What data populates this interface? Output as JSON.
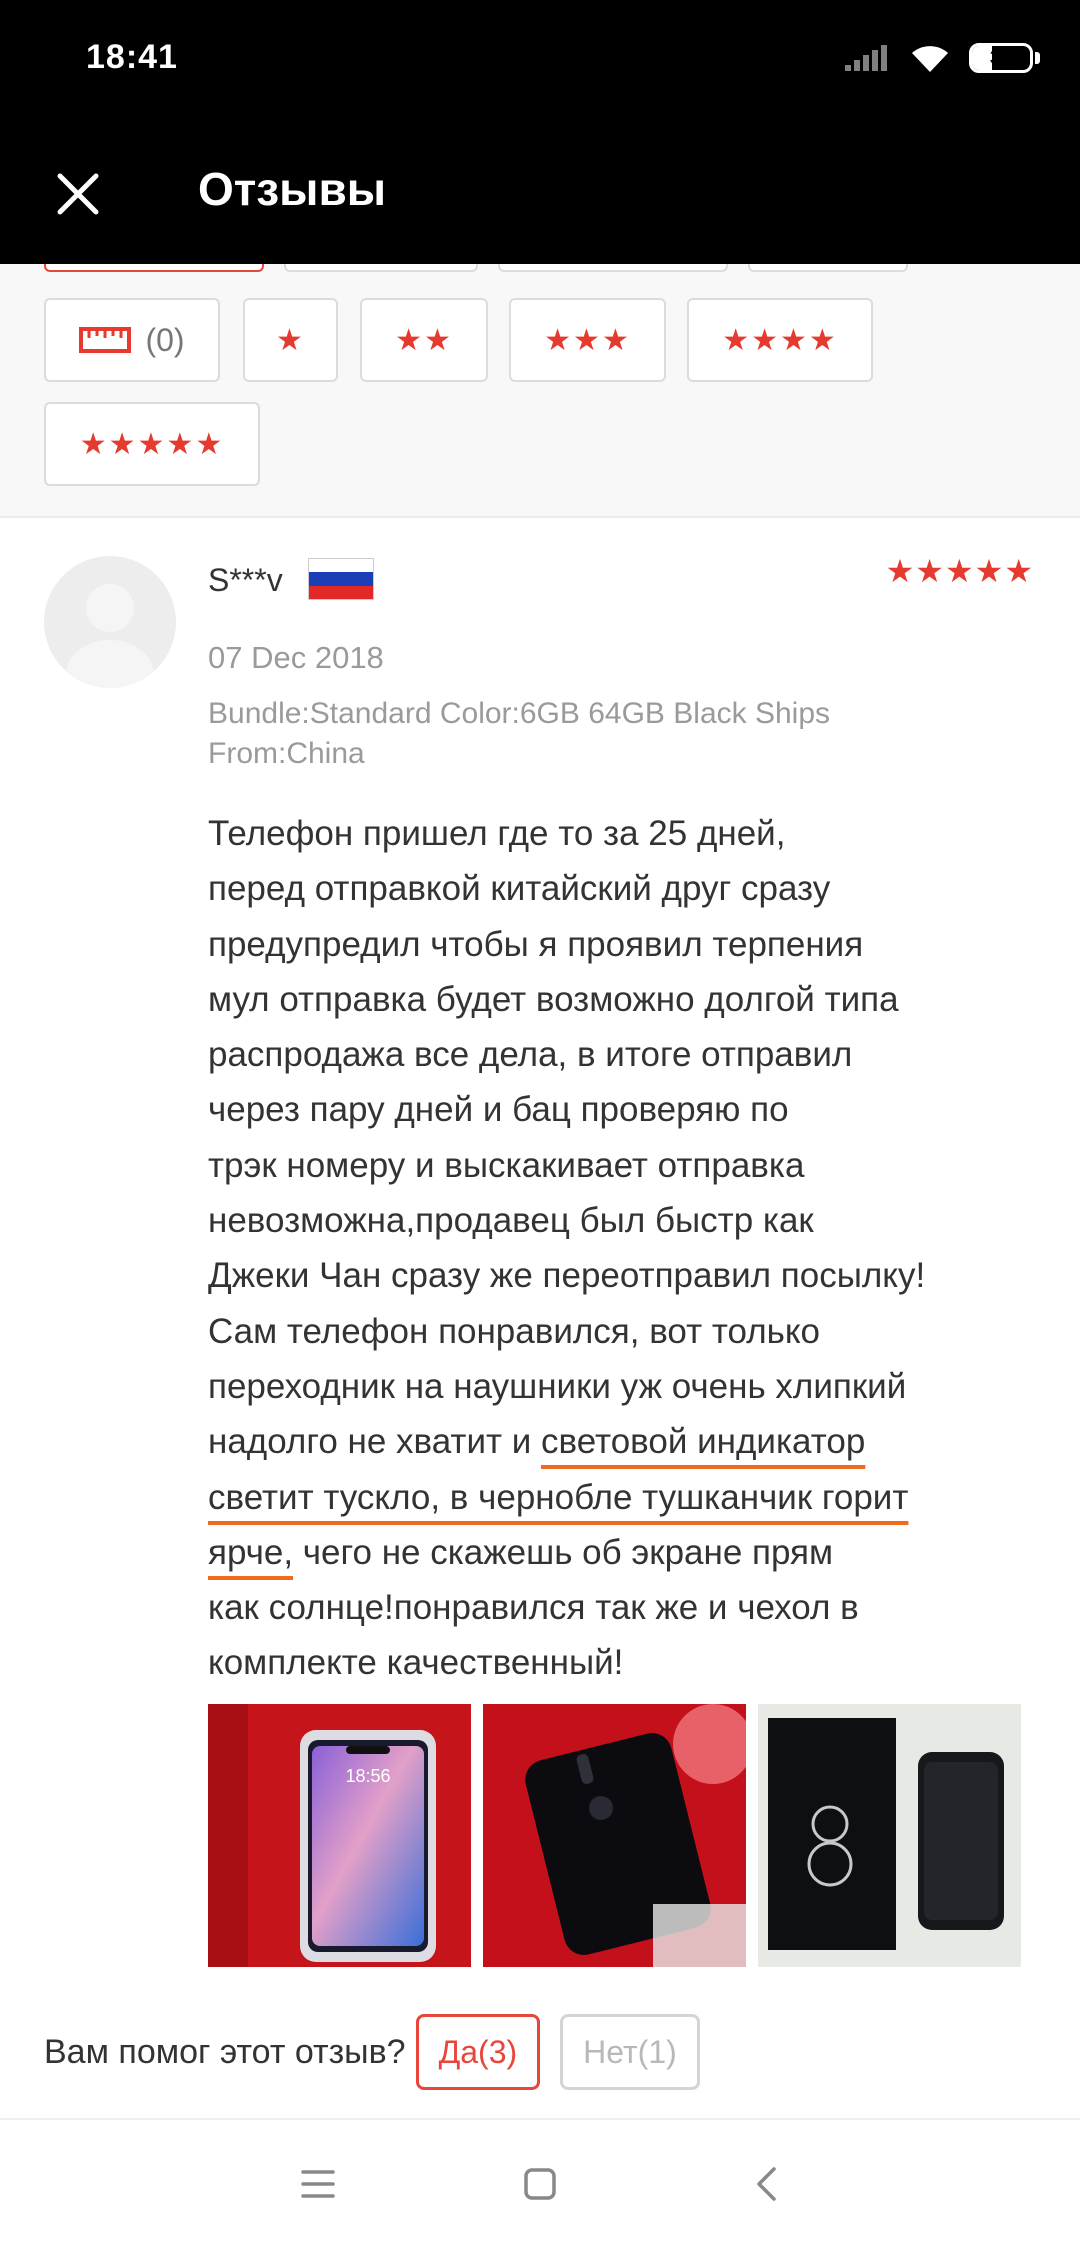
{
  "status_bar": {
    "time": "18:41",
    "battery_percent": "35",
    "battery_level": 0.35,
    "icons": [
      "signal-icon",
      "wifi-icon",
      "battery-icon"
    ]
  },
  "header": {
    "title": "Отзывы",
    "close_icon": "close-icon",
    "background": "#000000"
  },
  "filters": {
    "photo_chip": {
      "icon": "ruler-icon",
      "count": "(0)"
    },
    "star_chips": [
      {
        "stars": "★"
      },
      {
        "stars": "★★"
      },
      {
        "stars": "★★★"
      },
      {
        "stars": "★★★★"
      },
      {
        "stars": "★★★★★"
      }
    ],
    "accent": "#e8463b"
  },
  "review": {
    "author": "S***v",
    "country_flag": "russia-flag",
    "rating": 5,
    "rating_stars": "★★★★★",
    "date": "07 Dec 2018",
    "bundle_line1": "Bundle:Standard Color:6GB 64GB Black Ships",
    "bundle_line2": "From:China",
    "text_lines": [
      "Телефон пришел где то за 25 дней,",
      "перед отправкой китайский друг сразу",
      "предупредил чтобы я проявил терпения",
      "мул отправка будет возможно долгой типа",
      "распродажа все дела, в итоге отправил",
      "через пару дней и бац проверяю по",
      "трэк номеру и выскакивает отправка",
      "невозможна,продавец был быстр как",
      "Джеки Чан сразу же переотправил посылку!",
      "Сам телефон понравился, вот только",
      "переходник на наушники уж очень хлипкий"
    ],
    "line12_plain": "надолго не хватит и ",
    "line12_highlight": "световой индикатор",
    "line13_highlight": "светит тускло, в чернобле тушканчик горит",
    "line14_highlight": "ярче,",
    "line14_plain": " чего не скажешь об экране прям",
    "text_lines_end": [
      "как солнце!понравился так же и чехол в",
      "комплекте качественный!"
    ],
    "highlight_color": "#f26a1b",
    "photo_screen_time": "18:56",
    "photos": [
      "phone-front-photo",
      "phone-back-photo",
      "phone-box-photo"
    ]
  },
  "helpful": {
    "question": "Вам помог этот отзыв?",
    "yes_label": "Да(3)",
    "no_label": "Нет(1)"
  },
  "navbar": {
    "icons": [
      "menu-icon",
      "home-icon",
      "back-icon"
    ]
  }
}
